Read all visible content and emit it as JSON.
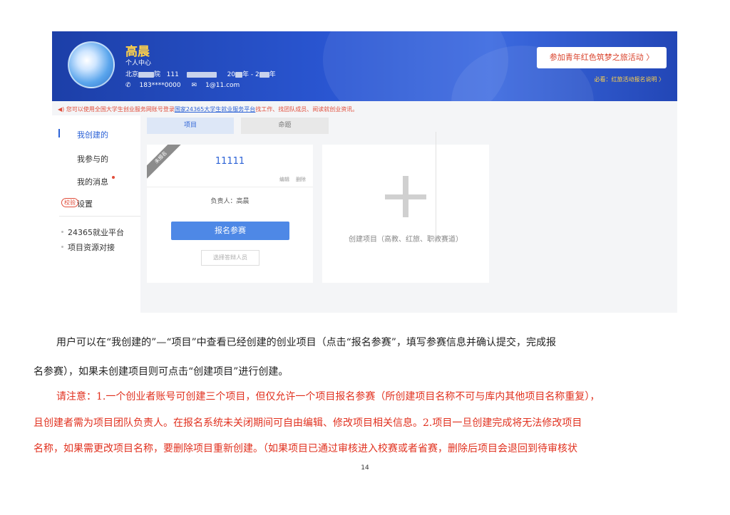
{
  "profile": {
    "name": "高晨",
    "center_label": "个人中心",
    "school_prefix": "北京",
    "school_suffix": "院",
    "school_code": "111",
    "year_from_prefix": "20",
    "year_mid": "年 - 2",
    "year_suffix": "年",
    "phone": "183****0000",
    "email": "1@11.com"
  },
  "banner": {
    "join_button": "参加青年红色筑梦之旅活动",
    "join_arrow": "〉",
    "must_read": "必看：红旅活动报名说明 〉"
  },
  "notice": {
    "prefix": "您可以使用全国大学生创业服务网账号登录",
    "link": "国家24365大学生就业服务平台",
    "suffix": "找工作、找团队成员、阅读就创业资讯。"
  },
  "sidebar": {
    "items": [
      "我创建的",
      "我参与的",
      "我的消息",
      "设置"
    ],
    "badge": "校验",
    "links": [
      "24365就业平台",
      "项目资源对接"
    ]
  },
  "tabs": [
    "项目",
    "命题"
  ],
  "project_card": {
    "ribbon": "未报名",
    "name": "11111",
    "edit": "编辑",
    "delete": "删除",
    "owner": "负责人：高晨",
    "signup_button": "报名参赛",
    "defender_button": "选择答辩人员"
  },
  "create_card": {
    "label": "创建项目（高教、红旅、职教赛道）"
  },
  "body_text": {
    "p1_line1": "用户可以在“我创建的”—“项目”中查看已经创建的创业项目（点击“报名参赛”，填写参赛信息并确认提交，完成报",
    "p1_line2": "名参赛），如果未创建项目则可点击“创建项目”进行创建。",
    "p2_line1": "请注意：1.一个创业者账号可创建三个项目，但仅允许一个项目报名参赛（所创建项目名称不可与库内其他项目名称重复），",
    "p2_line2": "且创建者需为项目团队负责人。在报名系统未关闭期间可自由编辑、修改项目相关信息。2.项目一旦创建完成将无法修改项目",
    "p2_line3": "名称，如果需更改项目名称，要删除项目重新创建。（如果项目已通过审核进入校赛或者省赛，删除后项目会退回到待审核状"
  },
  "page_number": "14",
  "colors": {
    "banner_blue": "#2a56d2",
    "accent_blue": "#2c62d6",
    "warning_red": "#e1311f",
    "name_gold": "#ffd24a"
  }
}
